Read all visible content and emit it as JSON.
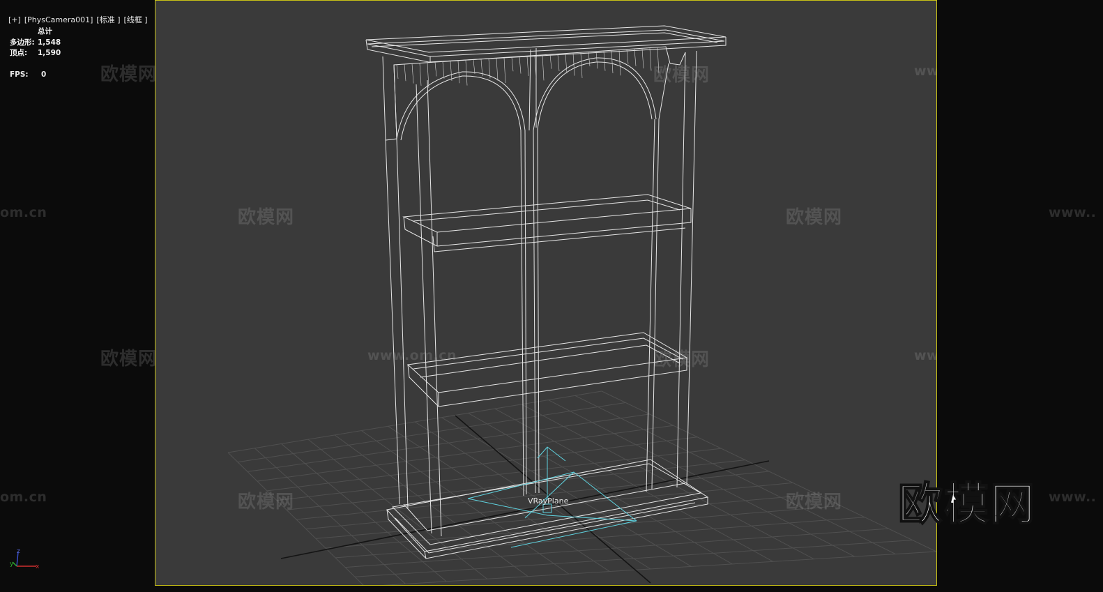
{
  "viewport": {
    "label_items": [
      "[+]",
      "[PhysCamera001]",
      "[标准 ]",
      "[线框 ]"
    ],
    "border_color": "#c9c216",
    "background": "#3a3a3a"
  },
  "stats": {
    "header": "总计",
    "polygons_label": "多边形:",
    "polygons_value": "1,548",
    "vertices_label": "顶点:",
    "vertices_value": "1,590",
    "fps_label": "FPS:",
    "fps_value": "0"
  },
  "scene": {
    "object_label": "VRayPlane",
    "wireframe_color": "#e6e6e6",
    "helper_color": "#5fd3e0",
    "grid_color": "#4f4f4f"
  },
  "watermarks": {
    "brand_text": "欧模网",
    "url_text": "www.om.cn",
    "url_fragment_left": "om.cn",
    "url_fragment_right": "www.."
  },
  "gizmo": {
    "x": "x",
    "y": "y",
    "z": "z"
  }
}
